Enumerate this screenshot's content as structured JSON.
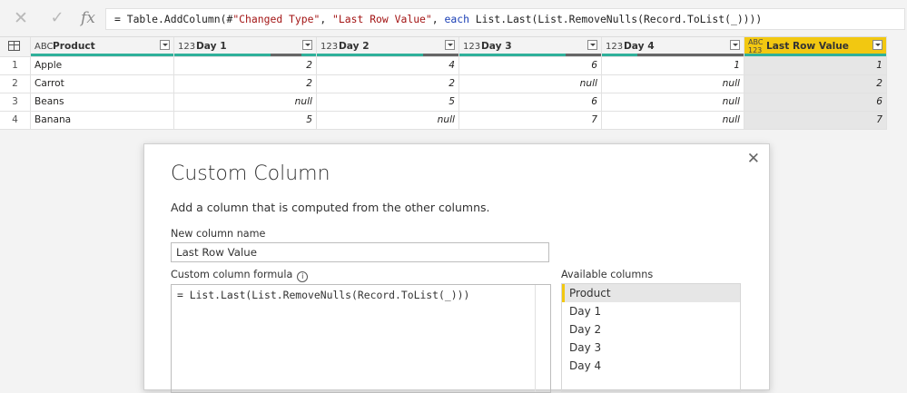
{
  "formula_bar": {
    "formula_prefix": "= Table.AddColumn(#",
    "formula_str1": "\"Changed Type\"",
    "formula_mid": ", ",
    "formula_str2": "\"Last Row Value\"",
    "formula_mid2": ", ",
    "formula_kw": "each",
    "formula_rest": " List.Last(List.RemoveNulls(Record.ToList(_))))",
    "cancel_icon": "✕",
    "commit_icon": "✓",
    "fx_icon": "fx"
  },
  "table": {
    "columns": [
      {
        "type_icon": "ABC",
        "label": "Product"
      },
      {
        "type_icon": "123",
        "label": "Day 1"
      },
      {
        "type_icon": "123",
        "label": "Day 2"
      },
      {
        "type_icon": "123",
        "label": "Day 3"
      },
      {
        "type_icon": "123",
        "label": "Day 4"
      },
      {
        "type_icon": "ABC 123",
        "label": "Last Row Value"
      }
    ],
    "rows": [
      {
        "idx": "1",
        "cells": [
          "Apple",
          "2",
          "4",
          "6",
          "1",
          "1"
        ]
      },
      {
        "idx": "2",
        "cells": [
          "Carrot",
          "2",
          "2",
          "null",
          "null",
          "2"
        ]
      },
      {
        "idx": "3",
        "cells": [
          "Beans",
          "null",
          "5",
          "6",
          "null",
          "6"
        ]
      },
      {
        "idx": "4",
        "cells": [
          "Banana",
          "5",
          "null",
          "7",
          "null",
          "7"
        ]
      }
    ]
  },
  "dialog": {
    "title": "Custom Column",
    "description": "Add a column that is computed from the other columns.",
    "new_column_label": "New column name",
    "new_column_value": "Last Row Value",
    "formula_label": "Custom column formula",
    "formula_value": "= List.Last(List.RemoveNulls(Record.ToList(_)))",
    "available_label": "Available columns",
    "available_columns": [
      "Product",
      "Day 1",
      "Day 2",
      "Day 3",
      "Day 4"
    ],
    "close_icon": "✕"
  }
}
